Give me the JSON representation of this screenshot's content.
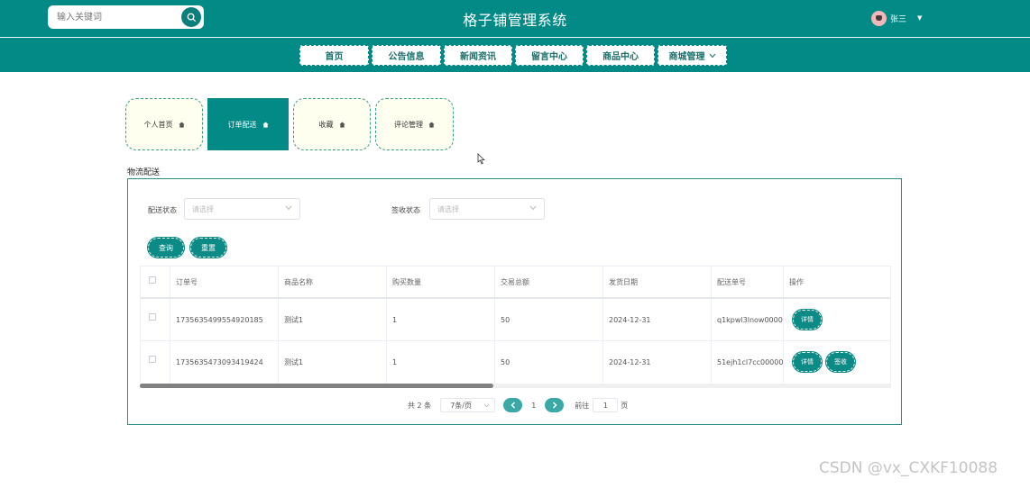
{
  "header": {
    "title": "格子铺管理系统",
    "search_placeholder": "输入关键词",
    "user_name": "张三"
  },
  "nav": {
    "items": [
      {
        "label": "首页"
      },
      {
        "label": "公告信息"
      },
      {
        "label": "新闻资讯"
      },
      {
        "label": "留言中心"
      },
      {
        "label": "商品中心"
      },
      {
        "label": "商城管理"
      }
    ]
  },
  "tabs": [
    {
      "label": "个人首页",
      "active": false
    },
    {
      "label": "订单配送",
      "active": true
    },
    {
      "label": "收藏",
      "active": false
    },
    {
      "label": "评论管理",
      "active": false
    }
  ],
  "section": {
    "title": "物流配送"
  },
  "filters": {
    "delivery_status_label": "配送状态",
    "delivery_status_placeholder": "请选择",
    "receipt_status_label": "签收状态",
    "receipt_status_placeholder": "请选择",
    "query_label": "查询",
    "reset_label": "重置"
  },
  "table": {
    "columns": [
      "订单号",
      "商品名称",
      "购买数量",
      "交易总额",
      "发货日期",
      "配送单号",
      "操作"
    ],
    "rows": [
      {
        "order_no": "1735635499554920185",
        "product": "测试1",
        "qty": "1",
        "total": "50",
        "ship_date": "2024-12-31",
        "tracking_no": "q1kpwl3lnow00000",
        "actions": [
          "详情"
        ]
      },
      {
        "order_no": "1735635473093419424",
        "product": "测试1",
        "qty": "1",
        "total": "50",
        "ship_date": "2024-12-31",
        "tracking_no": "51ejh1cl7cc00000",
        "actions": [
          "详情",
          "签收"
        ]
      }
    ]
  },
  "pagination": {
    "total_text": "共 2 条",
    "page_size_text": "7条/页",
    "current_page": "1",
    "goto_label": "前往",
    "goto_value": "1",
    "page_suffix": "页"
  },
  "watermark": "CSDN @vx_CXKF10088",
  "colors": {
    "primary": "#028a86",
    "tab_bg": "#fffff0",
    "border": "#3a9e87"
  }
}
